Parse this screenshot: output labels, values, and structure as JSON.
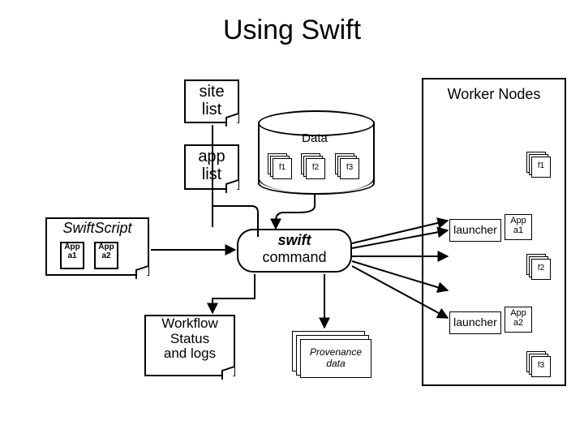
{
  "title": "Using Swift",
  "site_list": {
    "line1": "site",
    "line2": "list"
  },
  "app_list": {
    "line1": "app",
    "line2": "list"
  },
  "data_label": "Data",
  "files": {
    "f1": "f1",
    "f2": "f2",
    "f3": "f3"
  },
  "swiftscript": {
    "title": "SwiftScript",
    "app1": {
      "l1": "App",
      "l2": "a1"
    },
    "app2": {
      "l1": "App",
      "l2": "a2"
    }
  },
  "cmd": {
    "top": "swift",
    "bottom": "command"
  },
  "workflow": {
    "l1": "Workflow",
    "l2": "Status",
    "l3": "and logs"
  },
  "prov": {
    "l1": "Provenance",
    "l2": "data"
  },
  "workers": {
    "title": "Worker Nodes",
    "launcher": "launcher",
    "app1": {
      "l1": "App",
      "l2": "a1"
    },
    "app2": {
      "l1": "App",
      "l2": "a2"
    },
    "f1": "f1",
    "f2": "f2",
    "f3": "f3"
  }
}
